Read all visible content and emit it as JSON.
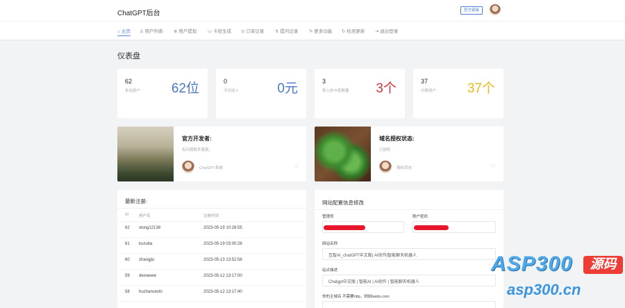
{
  "header": {
    "title": "ChatGPT后台",
    "badge": "官方链接"
  },
  "nav": [
    {
      "icon": "home-icon",
      "label": "⌂ 主页"
    },
    {
      "icon": "user-icon",
      "label": "用户列表"
    },
    {
      "icon": "plus-icon",
      "label": "用户提现"
    },
    {
      "icon": "card-icon",
      "label": "卡密生成"
    },
    {
      "icon": "order-icon",
      "label": "订单记录"
    },
    {
      "icon": "record-icon",
      "label": "提问记录"
    },
    {
      "icon": "more-icon",
      "label": "更多功能"
    },
    {
      "icon": "refresh-icon",
      "label": "检测更新"
    },
    {
      "icon": "logout-icon",
      "label": "退出登录"
    }
  ],
  "page_title": "仪表盘",
  "stats": [
    {
      "num": "62",
      "label": "本站用户",
      "big": "62位",
      "color": "#4a78c2"
    },
    {
      "num": "0",
      "label": "今日收入",
      "big": "0元",
      "color": "#4a78c2"
    },
    {
      "num": "3",
      "label": "导入的卡密数量",
      "big": "3个",
      "color": "#d0313a"
    },
    {
      "num": "37",
      "label": "付费用户",
      "big": "37个",
      "color": "#e9b81f"
    }
  ],
  "dev_card": {
    "title": "官方开发者:",
    "subtitle": "有问题联系客服。",
    "footer": "ChatGPT系统"
  },
  "domain_card": {
    "title": "域名授权状态:",
    "subtitle": "已授权",
    "footer": "授权状态"
  },
  "recent": {
    "title": "最新注册:",
    "columns": [
      "ID",
      "用户名",
      "注册时间"
    ],
    "rows": [
      [
        "62",
        "xiong12138",
        "2023-05-19 10:28:55"
      ],
      [
        "61",
        "kuzuba",
        "2023-05-19 03:00:28"
      ],
      [
        "60",
        "zhangjiu",
        "2023-05-13 13:52:58"
      ],
      [
        "59",
        "dexweew",
        "2023-05-12 13:17:00"
      ],
      [
        "58",
        "huzhanceshi",
        "2023-05-12 13:17:40"
      ]
    ]
  },
  "config": {
    "title": "网站配置信息修改",
    "admin_label": "管理员",
    "account_label": "账户密码",
    "site_name_label": "网站名称",
    "site_name_value": "互智AI_chatGPT中文版| AI创作|智能聊天机器人",
    "site_desc_label": "站点描述",
    "site_desc_value": "Chatgpt中文版 | 智能AI | AI创作 | 智能聊天机器人",
    "domain_label": "你的主域名 不需要http，例如baidu.com"
  },
  "watermark": {
    "main": "ASP300",
    "tag": "源码",
    "url": "asp300.cn"
  }
}
